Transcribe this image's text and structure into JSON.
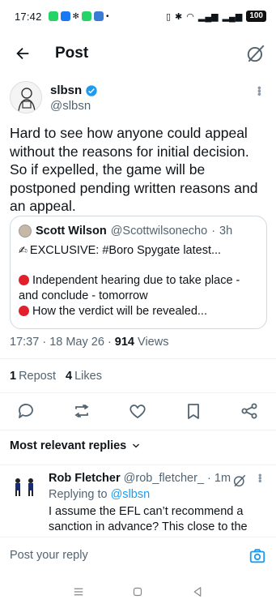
{
  "status_bar": {
    "time": "17:42",
    "battery": "100"
  },
  "header": {
    "title": "Post"
  },
  "post": {
    "author_name": "slbsn",
    "author_handle": "@slbsn",
    "text": "Hard to see how anyone could appeal without the reasons for initial decision. So if expelled, the game will be postponed pending written reasons and an appeal.",
    "time": "17:37",
    "date": "18 May 26",
    "views_count": "914",
    "views_label": "Views",
    "reposts_count": "1",
    "reposts_label": "Repost",
    "likes_count": "4",
    "likes_label": "Likes"
  },
  "quote": {
    "author_name": "Scott Wilson",
    "author_handle": "@Scottwilsonecho",
    "time": "3h",
    "line1": "EXCLUSIVE: #Boro Spygate latest...",
    "line2": "Independent hearing due to take place -",
    "line3": "and conclude - tomorrow",
    "line4": "How the verdict will be revealed..."
  },
  "replies": {
    "sort_label": "Most relevant replies",
    "items": [
      {
        "author_name": "Rob Fletcher",
        "author_handle": "@rob_fletcher_",
        "time": "1m",
        "replying_prefix": "Replying to",
        "replying_to": "@slbsn",
        "text": "I assume the EFL can’t recommend a sanction in advance? This close to the"
      }
    ]
  },
  "composer": {
    "placeholder": "Post your reply"
  },
  "colors": {
    "accent": "#1d9bf0",
    "secondary_text": "#536471",
    "primary_text": "#0f1419",
    "verified": "#1d9bf0",
    "red_dot": "#e0202a"
  }
}
